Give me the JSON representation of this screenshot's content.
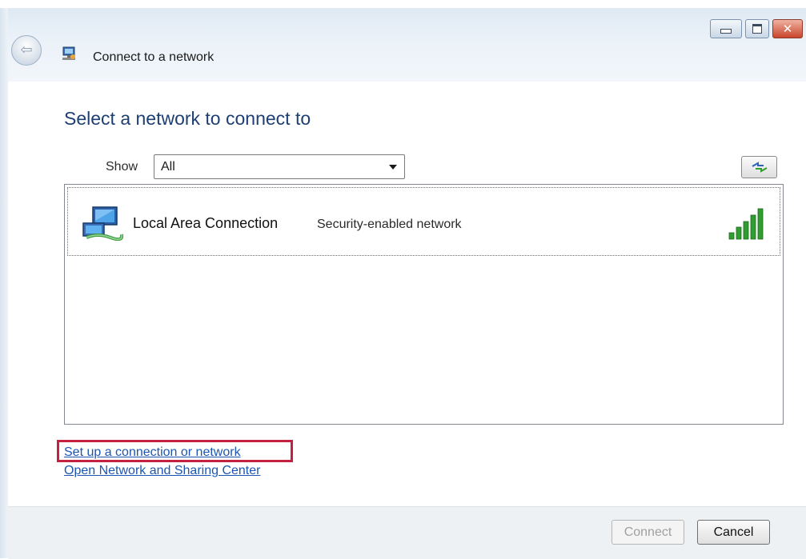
{
  "window": {
    "title": "Connect to a network",
    "controls": {
      "minimize": "minimize-icon",
      "maximize": "maximize-icon",
      "close": "close-icon"
    }
  },
  "main": {
    "heading": "Select a network to connect to",
    "show_label": "Show",
    "show_selected": "All"
  },
  "networks": [
    {
      "name": "Local Area Connection",
      "security": "Security-enabled network",
      "signal_bars": 5,
      "signal_max": 5
    }
  ],
  "links": {
    "setup": "Set up a connection or network",
    "sharing_center": "Open Network and Sharing Center"
  },
  "buttons": {
    "connect": "Connect",
    "cancel": "Cancel"
  },
  "colors": {
    "heading": "#1e3f73",
    "link": "#1c56b0",
    "highlight": "#c4203f",
    "signal": "#2f9d2f"
  }
}
